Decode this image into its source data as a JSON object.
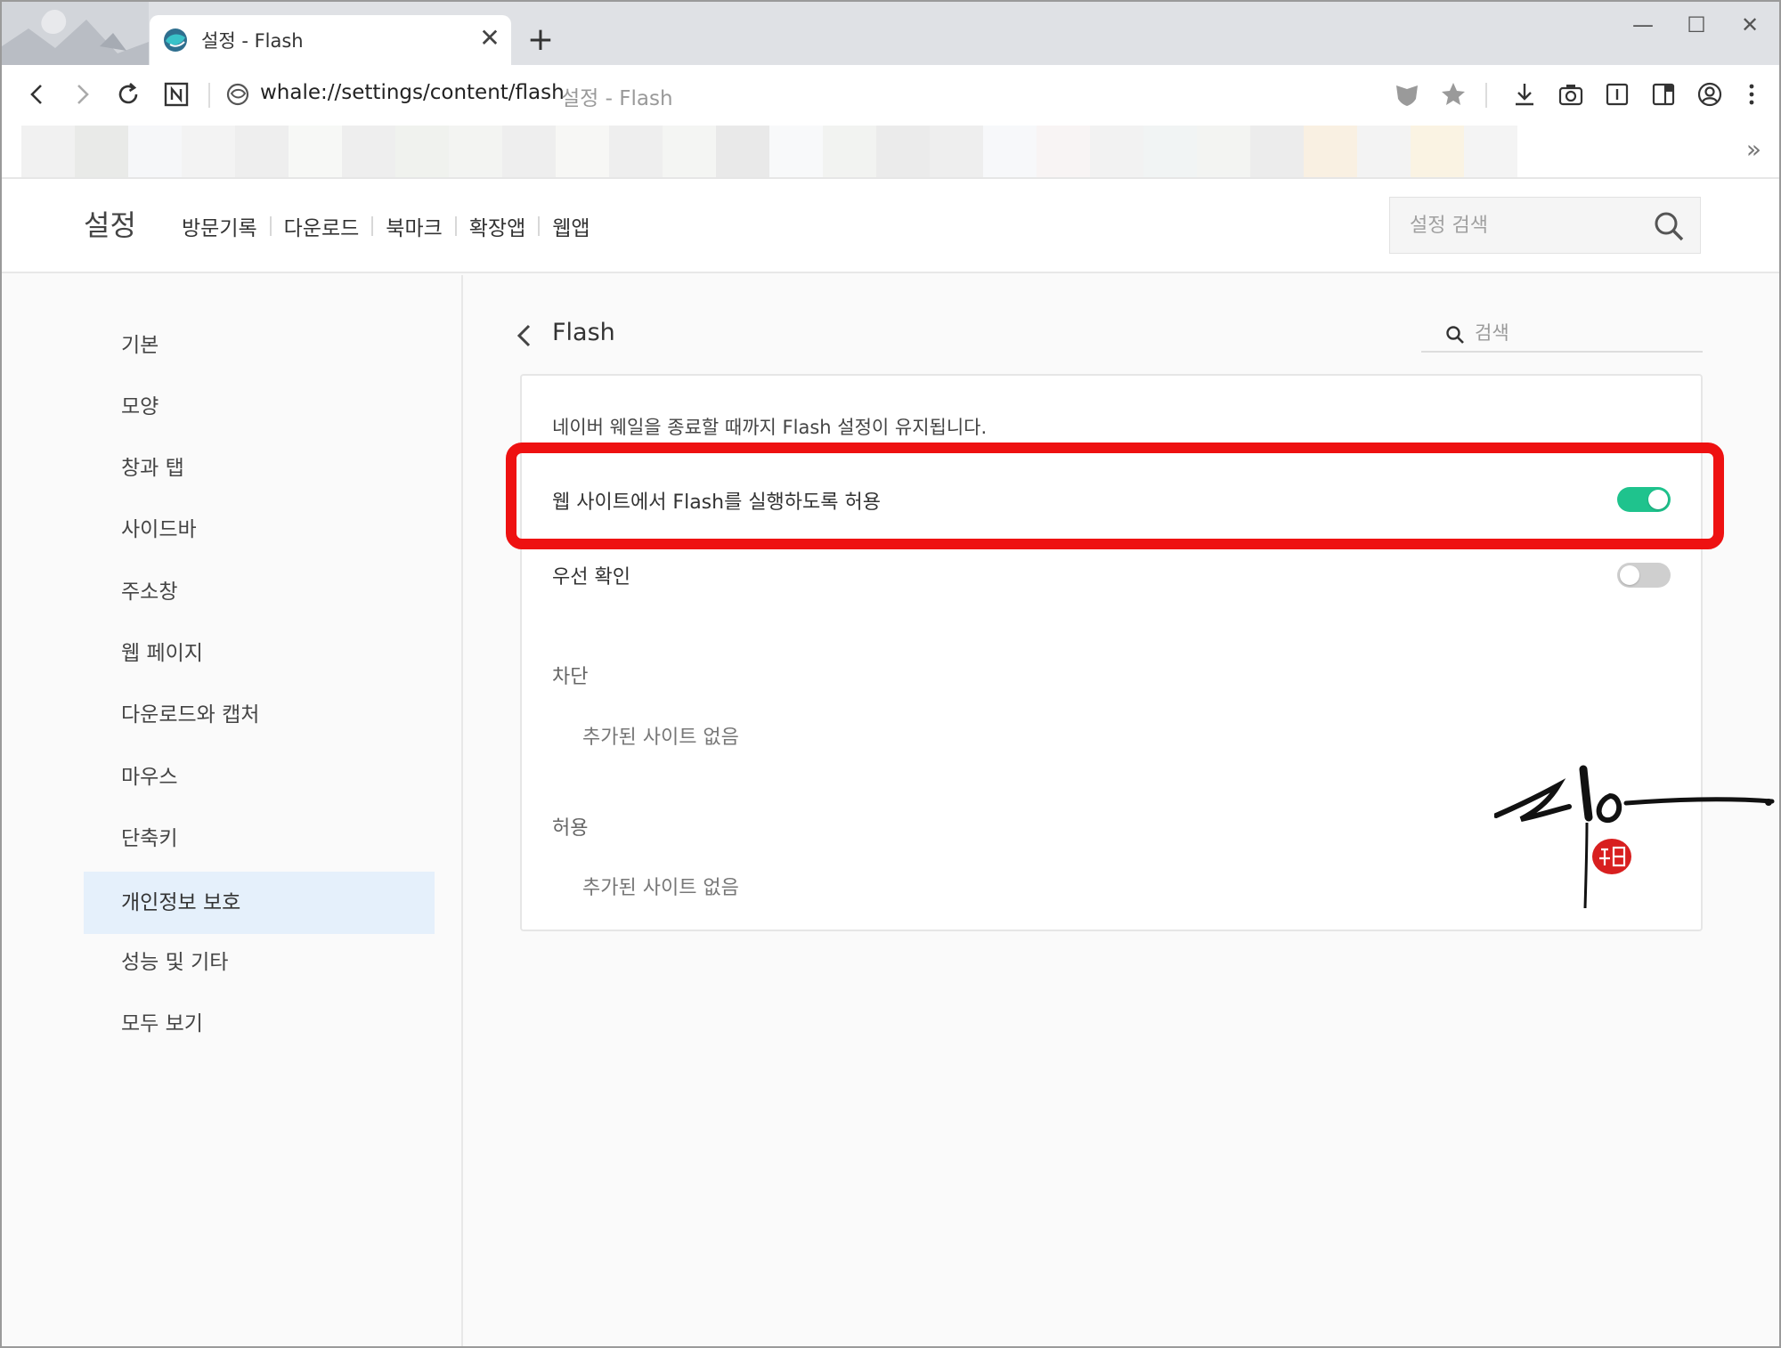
{
  "browser": {
    "tab": {
      "title": "설정 - Flash",
      "close_glyph": "✕"
    },
    "new_tab_glyph": "+",
    "window_controls": {
      "minimize": "—",
      "maximize": "☐",
      "close": "✕"
    },
    "address": {
      "url": "whale://settings/content/flash",
      "page_title": "설정 - Flash"
    },
    "bookmarks_overflow": "»"
  },
  "header": {
    "title": "설정",
    "nav": [
      "방문기록",
      "다운로드",
      "북마크",
      "확장앱",
      "웹앱"
    ],
    "search_placeholder": "설정 검색"
  },
  "sidebar": {
    "items": [
      {
        "label": "기본"
      },
      {
        "label": "모양"
      },
      {
        "label": "창과 탭"
      },
      {
        "label": "사이드바"
      },
      {
        "label": "주소창"
      },
      {
        "label": "웹 페이지"
      },
      {
        "label": "다운로드와 캡처"
      },
      {
        "label": "마우스"
      },
      {
        "label": "단축키"
      },
      {
        "label": "개인정보 보호",
        "active": true
      },
      {
        "label": "성능 및 기타"
      },
      {
        "label": "모두 보기"
      }
    ]
  },
  "main": {
    "title": "Flash",
    "search_placeholder": "검색",
    "description": "네이버 웨일을 종료할 때까지 Flash 설정이 유지됩니다.",
    "allow_flash": {
      "label": "웹 사이트에서 Flash를 실행하도록 허용",
      "enabled": true
    },
    "ask_first": {
      "label": "우선 확인",
      "enabled": false
    },
    "block": {
      "label": "차단",
      "empty": "추가된 사이트 없음"
    },
    "allow": {
      "label": "허용",
      "empty": "추가된 사이트 없음"
    }
  },
  "colors": {
    "toggle_on": "#1fc38d",
    "toggle_off": "#cfcfcf",
    "highlight": "#ee1111",
    "active_sidebar": "#e5f0fb"
  },
  "bookmark_swatches": [
    "#f1f1f1",
    "#e9eae8",
    "#f6f7f9",
    "#f3f3f3",
    "#eeeeee",
    "#f7f8f6",
    "#eeeeee",
    "#f0f2ee",
    "#f3f4f2",
    "#eeeeee",
    "#f7f7f5",
    "#eeeeee",
    "#f4f5f3",
    "#e9e9e9",
    "#f8f9fa",
    "#f2f3f1",
    "#ebebeb",
    "#eeeeee",
    "#f7f8fa",
    "#f8f4f4",
    "#f2f2f2",
    "#f1f4f4",
    "#f3f4f2",
    "#ececec",
    "#f9f0e2",
    "#f3f3f3",
    "#faf3e3",
    "#f4f4f4"
  ]
}
